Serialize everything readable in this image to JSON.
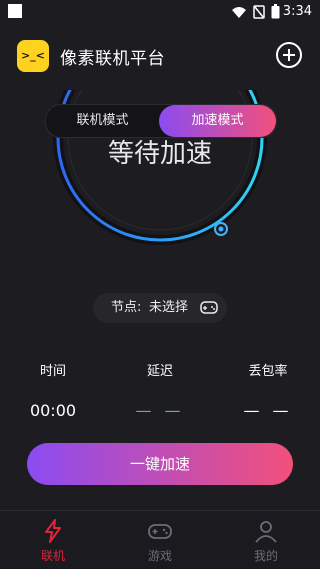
{
  "status_bar": {
    "time": "3:34",
    "icons": [
      "wifi-icon",
      "no-sim-icon",
      "battery-icon"
    ]
  },
  "header": {
    "title": "像素联机平台",
    "logo_face": ">_<"
  },
  "gauge": {
    "status_text": "等待加速",
    "colors": {
      "arc_start": "#2f6bff",
      "arc_end": "#2fe0ff"
    }
  },
  "mode_tabs": [
    {
      "label": "联机模式",
      "active": false
    },
    {
      "label": "加速模式",
      "active": true
    }
  ],
  "node": {
    "label": "节点:",
    "value": "未选择"
  },
  "stats": {
    "time": {
      "title": "时间",
      "value": "00:00"
    },
    "delay": {
      "title": "延迟",
      "value": "— —"
    },
    "loss": {
      "title": "丢包率",
      "value": "— —"
    }
  },
  "cta": {
    "label": "一键加速"
  },
  "tabbar": [
    {
      "label": "联机",
      "active": true,
      "icon": "lightning-icon"
    },
    {
      "label": "游戏",
      "active": false,
      "icon": "gamepad-icon"
    },
    {
      "label": "我的",
      "active": false,
      "icon": "user-icon"
    }
  ],
  "colors": {
    "background": "#1d1d21",
    "accent_gradient": [
      "#8b4cf2",
      "#f2507a"
    ],
    "active_tab": "#e0243b",
    "inactive_tab": "#6c6c74"
  }
}
